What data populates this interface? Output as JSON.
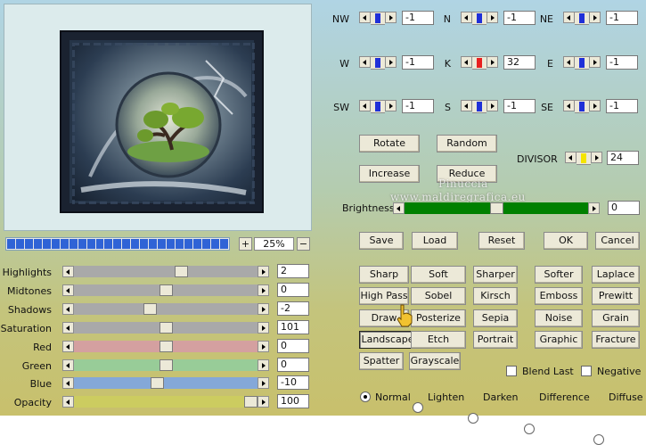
{
  "preview": {
    "alt": "tree in bubble preview"
  },
  "progress": {
    "segments": 25
  },
  "zoom": {
    "plus": "+",
    "minus": "−",
    "value": "25%"
  },
  "sliders": [
    {
      "label": "Highlights",
      "value": "2",
      "level": 0.59,
      "color": "#a9a9a9"
    },
    {
      "label": "Midtones",
      "value": "0",
      "level": 0.5,
      "color": "#a9a9a9"
    },
    {
      "label": "Shadows",
      "value": "-2",
      "level": 0.41,
      "color": "#a9a9a9"
    },
    {
      "label": "Saturation",
      "value": "101",
      "level": 0.5,
      "color": "#a9a9a9"
    },
    {
      "label": "Red",
      "value": "0",
      "level": 0.5,
      "color": "#d4a0a0"
    },
    {
      "label": "Green",
      "value": "0",
      "level": 0.5,
      "color": "#98cc98"
    },
    {
      "label": "Blue",
      "value": "-10",
      "level": 0.45,
      "color": "#84a8d8"
    },
    {
      "label": "Opacity",
      "value": "100",
      "level": 1.0,
      "color": "#cccc60"
    }
  ],
  "matrix": [
    {
      "label": "NW",
      "value": "-1"
    },
    {
      "label": "N",
      "value": "-1"
    },
    {
      "label": "NE",
      "value": "-1"
    },
    {
      "label": "W",
      "value": "-1"
    },
    {
      "label": "K",
      "value": "32"
    },
    {
      "label": "E",
      "value": "-1"
    },
    {
      "label": "SW",
      "value": "-1"
    },
    {
      "label": "S",
      "value": "-1"
    },
    {
      "label": "SE",
      "value": "-1"
    }
  ],
  "divisor": {
    "label": "DIVISOR",
    "value": "24"
  },
  "brightness": {
    "label": "Brightness",
    "value": "0",
    "level": 0.5,
    "color": "#008000"
  },
  "buttons": {
    "rotate": "Rotate",
    "random": "Random",
    "increase": "Increase",
    "reduce": "Reduce",
    "save": "Save",
    "load": "Load",
    "reset": "Reset",
    "ok": "OK",
    "cancel": "Cancel"
  },
  "presets": [
    [
      "Sharp",
      "Soft",
      "Sharper",
      "Softer",
      "Laplace"
    ],
    [
      "High Pass",
      "Sobel",
      "Kirsch",
      "Emboss",
      "Prewitt"
    ],
    [
      "Draw",
      "Posterize",
      "Sepia",
      "Noise",
      "Grain"
    ],
    [
      "Landscape",
      "Etch",
      "Portrait",
      "Graphic",
      "Fracture"
    ],
    [
      "Spatter",
      "Grayscale"
    ]
  ],
  "options": {
    "blend_last": "Blend Last",
    "negative": "Negative"
  },
  "modes": {
    "selected": "Normal",
    "items": [
      "Normal",
      "Lighten",
      "Darken",
      "Difference",
      "Diffuse"
    ]
  },
  "watermark": {
    "line1": "Pinuccia",
    "line2": "www.maldiregrafica.eu"
  }
}
